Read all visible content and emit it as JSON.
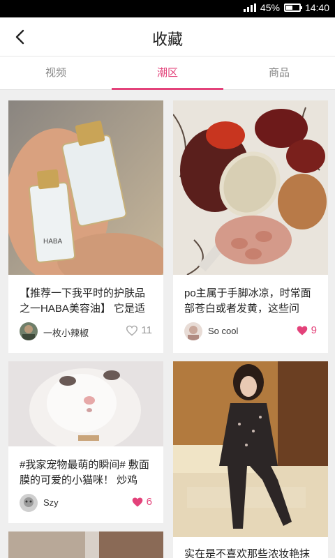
{
  "status_bar": {
    "battery": "45%",
    "time": "14:40"
  },
  "header": {
    "title": "收藏"
  },
  "tabs": [
    {
      "label": "视频",
      "active": false
    },
    {
      "label": "潮区",
      "active": true
    },
    {
      "label": "商品",
      "active": false
    }
  ],
  "posts": [
    {
      "text": "【推荐一下我平时的护肤品之一HABA美容油】 它是适",
      "user": "一枚小辣椒",
      "likes": "11",
      "liked": false,
      "image_label": "HABA"
    },
    {
      "text": "po主属于手脚冰凉，时常面部苍白或者发黄，这些问",
      "user": "So cool",
      "likes": "9",
      "liked": true
    },
    {
      "text": "#我家宠物最萌的瞬间# 敷面膜的可爱的小猫咪！ 炒鸡",
      "user": "Szy",
      "likes": "6",
      "liked": true
    },
    {
      "text": "实在是不喜欢那些浓妆艳抹",
      "user": "",
      "likes": "",
      "liked": false
    }
  ],
  "colors": {
    "accent": "#e3427a",
    "background": "#efefef"
  }
}
